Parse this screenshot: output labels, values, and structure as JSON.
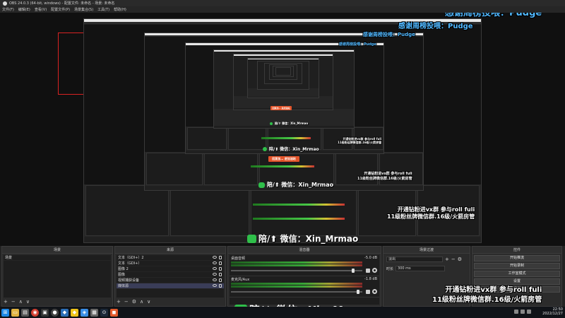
{
  "window": {
    "title": "OBS 24.0.3 (64-bit, windows) - 配置文件: 未命名 - 场景: 未命名",
    "menu": [
      "文件(F)",
      "编辑(E)",
      "查看(V)",
      "配置文件(P)",
      "场景集合(S)",
      "工具(T)",
      "帮助(H)"
    ]
  },
  "overlay": {
    "bullets": [
      "感谢周榜投喂：Pudge",
      "感谢周榜投喂：Pudge",
      "感谢周榜投喂：Pudge",
      "感谢周榜投喂：Pudge"
    ],
    "promo_line1": "开通钻粉进vx群 参与roll fuli",
    "promo_line2": "11级粉丝牌微信群.16级/火箭房管",
    "wechat": "陪/⬆ 微信：Xin_Mrmao",
    "orange_btn": "回复加… 进加油站"
  },
  "docks": {
    "scenes": {
      "title": "场景",
      "items": [
        "场景"
      ]
    },
    "sources": {
      "title": "来源",
      "items": [
        "文本（GDI+）2",
        "文本（GDI+）",
        "图像 2",
        "图像",
        "视频捕获设备",
        "媒体源"
      ]
    },
    "mixer": {
      "title": "混音器",
      "channels": [
        {
          "label": "桌面音频",
          "db": "-5.0 dB"
        },
        {
          "label": "麦克风/Aux",
          "db": "-1.8 dB"
        }
      ]
    },
    "transitions": {
      "title": "场景过渡",
      "selected": "淡出",
      "duration_label": "时长",
      "duration_value": "300 ms"
    },
    "controls": {
      "title": "控件",
      "buttons": [
        "开始推流",
        "开始录制",
        "工作室模式",
        "设置",
        "退出"
      ]
    },
    "footer_symbols": {
      "add": "+",
      "remove": "−",
      "up": "∧",
      "down": "∨",
      "gear": "⚙"
    }
  },
  "clock": {
    "time": "22:50",
    "date": "2022/12/27"
  },
  "colors": {
    "accent_blue": "#4fb7ff",
    "record_red": "#d82222",
    "wechat_green": "#2fbf4a",
    "orange": "#e3542a"
  }
}
